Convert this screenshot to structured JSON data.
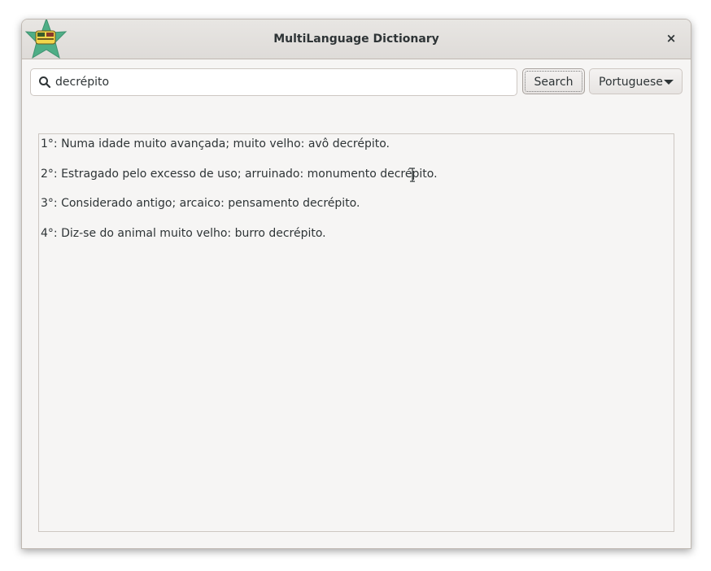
{
  "window": {
    "title": "MultiLanguage Dictionary",
    "close_glyph": "×",
    "logo_icon": "app-star-logo-icon"
  },
  "search": {
    "value": "decrépito",
    "icon": "search-icon",
    "button_label": "Search"
  },
  "language": {
    "selected": "Portuguese",
    "icon": "chevron-down-icon"
  },
  "results": [
    "1°: Numa idade muito avançada; muito velho: avô decrépito.",
    "2°: Estragado pelo excesso de uso; arruinado: monumento decrépito.",
    "3°: Considerado antigo; arcaico: pensamento decrépito.",
    "4°: Diz-se do animal muito velho: burro decrépito."
  ],
  "colors": {
    "logo_green": "#4fae86",
    "logo_yellow": "#f2d64b",
    "text": "#2e3436"
  }
}
